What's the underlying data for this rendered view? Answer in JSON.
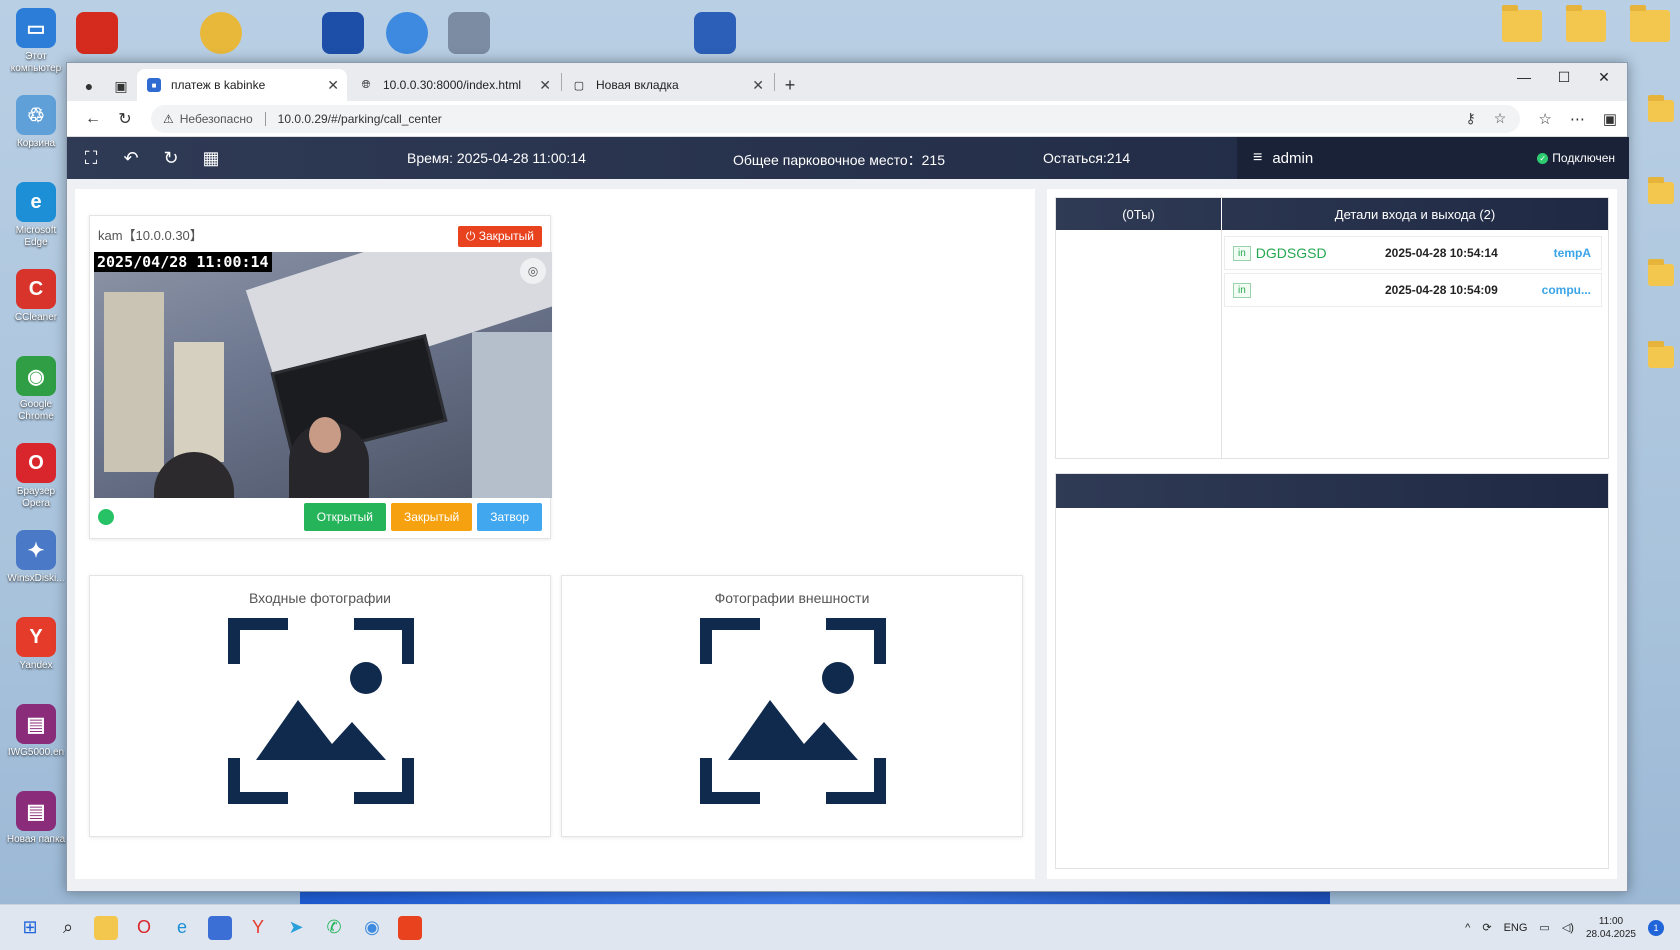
{
  "desktop": {
    "left_icons": [
      {
        "label": "Этот компьютер",
        "color": "#2b7dd8",
        "glyph": "▭"
      },
      {
        "label": "Корзина",
        "color": "#5fa0d9",
        "glyph": "♲"
      },
      {
        "label": "Microsoft Edge",
        "color": "#1c8fd6",
        "glyph": "e"
      },
      {
        "label": "CCleaner",
        "color": "#d9342b",
        "glyph": "C"
      },
      {
        "label": "Google Chrome",
        "color": "#2f9e44",
        "glyph": "◉"
      },
      {
        "label": "Браузер Opera",
        "color": "#d9262c",
        "glyph": "O"
      },
      {
        "label": "WinsxDiski...",
        "color": "#4a7ac7",
        "glyph": "✦"
      },
      {
        "label": "Yandex",
        "color": "#e43b2b",
        "glyph": "Y"
      },
      {
        "label": "IWG5000.en",
        "color": "#8a2c7a",
        "glyph": "▤"
      },
      {
        "label": "Новая папка",
        "color": "#8a2c7a",
        "glyph": "▤"
      }
    ]
  },
  "browser": {
    "tabs": [
      {
        "label": "платеж в kabinke",
        "active": true
      },
      {
        "label": "10.0.0.30:8000/index.html",
        "active": false
      },
      {
        "label": "Новая вкладка",
        "active": false
      }
    ],
    "address": {
      "insecure_label": "Небезопасно",
      "url": "10.0.0.29/#/parking/call_center"
    }
  },
  "app": {
    "header": {
      "time_label": "Время:  2025-04-28 11:00:14",
      "total_label": "Общее парковочное место：215",
      "remain_label": "Остаться:214",
      "user": "admin",
      "status": "Подключен"
    },
    "camera": {
      "title": "kam【10.0.0.30】",
      "badge": "Закрытый",
      "timestamp": "2025/04/28  11:00:14",
      "buttons": {
        "open": "Открытый",
        "close": "Закрытый",
        "gate": "Затвор"
      }
    },
    "photos": {
      "entry_title": "Входные фотографии",
      "appearance_title": "Фотографии внешности"
    },
    "events": {
      "left_header": "(0Ты)",
      "right_header": "Детали входа и выхода  (2)",
      "rows": [
        {
          "tag": "in",
          "plate": "DGDSGSD",
          "time": "2025-04-28 10:54:14",
          "who": "tempA"
        },
        {
          "tag": "in",
          "plate": "",
          "time": "2025-04-28 10:54:09",
          "who": "compu..."
        }
      ]
    }
  },
  "taskbar": {
    "lang": "ENG",
    "time": "11:00",
    "date": "28.04.2025",
    "notifications": "1"
  }
}
